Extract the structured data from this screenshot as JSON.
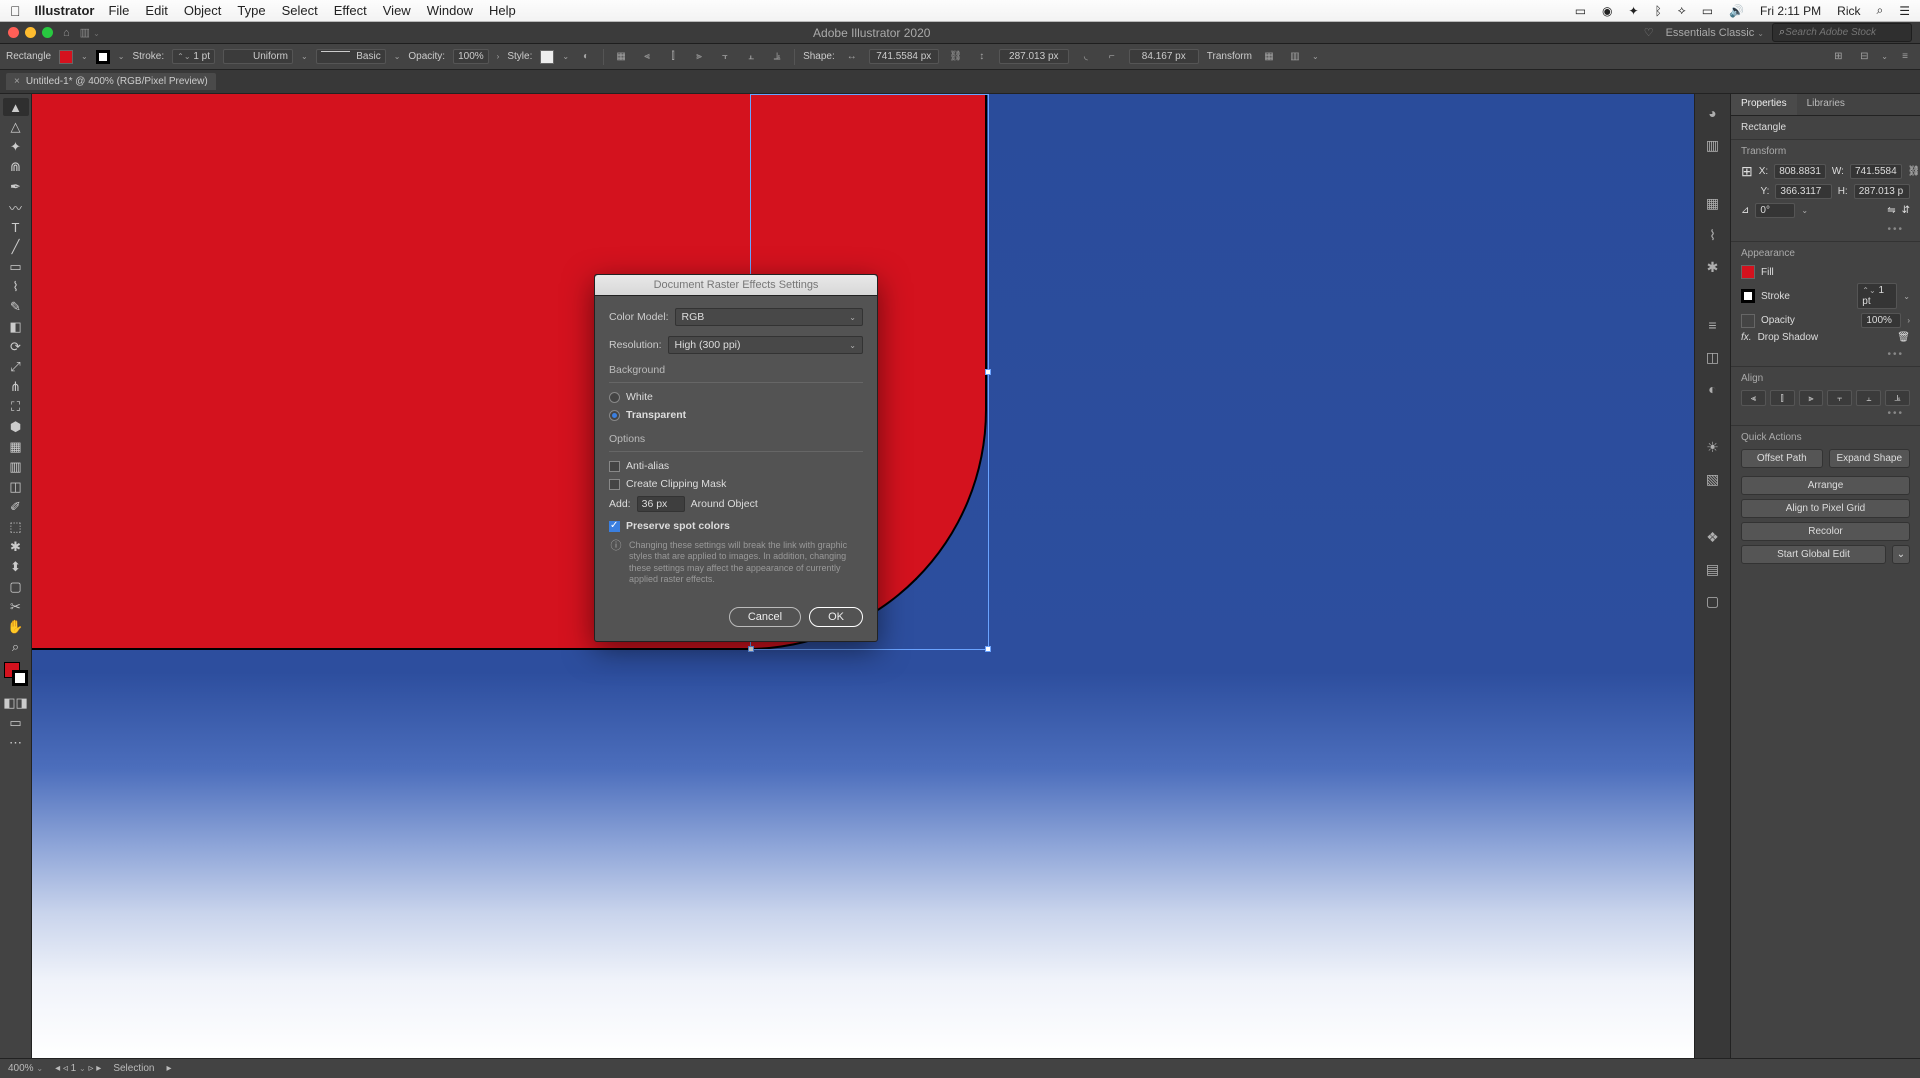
{
  "menubar": {
    "app": "Illustrator",
    "items": [
      "File",
      "Edit",
      "Object",
      "Type",
      "Select",
      "Effect",
      "View",
      "Window",
      "Help"
    ],
    "clock": "Fri 2:11 PM",
    "user": "Rick"
  },
  "titlebar": {
    "title": "Adobe Illustrator 2020",
    "workspace": "Essentials Classic",
    "search_placeholder": "Search Adobe Stock"
  },
  "controlbar": {
    "shape": "Rectangle",
    "fill_color": "#d4121e",
    "stroke_label": "Stroke:",
    "stroke_weight": "1 pt",
    "brush_label": "Uniform",
    "profile_label": "Basic",
    "opacity_label": "Opacity:",
    "opacity_value": "100%",
    "style_label": "Style:",
    "shape_label": "Shape:",
    "width_value": "741.5584 px",
    "height_value": "287.013 px",
    "corner_value": "84.167 px",
    "transform_label": "Transform"
  },
  "doctab": {
    "label": "Untitled-1* @ 400% (RGB/Pixel Preview)"
  },
  "dialog": {
    "title": "Document Raster Effects Settings",
    "color_model_label": "Color Model:",
    "color_model_value": "RGB",
    "resolution_label": "Resolution:",
    "resolution_value": "High (300 ppi)",
    "background_label": "Background",
    "white_label": "White",
    "transparent_label": "Transparent",
    "background_selected": "transparent",
    "options_label": "Options",
    "anti_alias_label": "Anti-alias",
    "anti_alias_checked": false,
    "clipping_label": "Create Clipping Mask",
    "clipping_checked": false,
    "add_label": "Add:",
    "add_value": "36 px",
    "around_label": "Around Object",
    "preserve_label": "Preserve spot colors",
    "preserve_checked": true,
    "info_text": "Changing these settings will break the link with graphic styles that are applied to images. In addition, changing these settings may affect the appearance of currently applied raster effects.",
    "cancel_label": "Cancel",
    "ok_label": "OK"
  },
  "properties": {
    "tabs": [
      "Properties",
      "Libraries"
    ],
    "shape_type": "Rectangle",
    "transform_label": "Transform",
    "x_label": "X:",
    "x_value": "808.8831",
    "y_label": "Y:",
    "y_value": "366.3117",
    "w_label": "W:",
    "w_value": "741.5584",
    "h_label": "H:",
    "h_value": "287.013 p",
    "rotate_value": "0°",
    "appearance_label": "Appearance",
    "fill_label": "Fill",
    "stroke_label": "Stroke",
    "stroke_value": "1 pt",
    "opacity_label": "Opacity",
    "opacity_value": "100%",
    "effect_label": "Drop Shadow",
    "align_label": "Align",
    "quick_label": "Quick Actions",
    "buttons": [
      "Offset Path",
      "Expand Shape",
      "Arrange",
      "Align to Pixel Grid",
      "Recolor",
      "Start Global Edit"
    ]
  },
  "statusbar": {
    "zoom": "400%",
    "artboard_num": "1",
    "tool": "Selection"
  },
  "colors": {
    "red": "#d4121e"
  }
}
